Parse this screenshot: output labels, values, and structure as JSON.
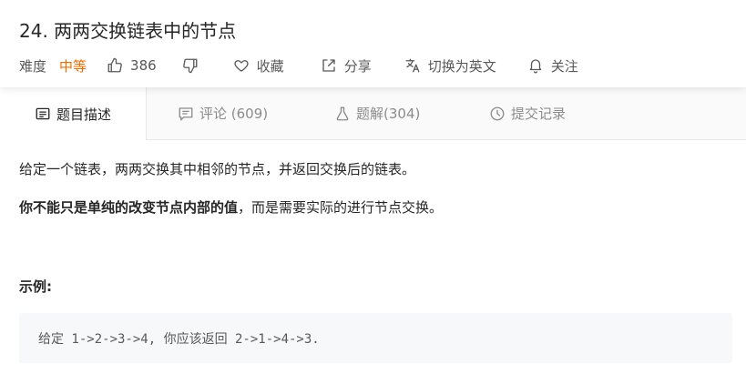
{
  "problem": {
    "title": "24. 两两交换链表中的节点"
  },
  "meta": {
    "difficulty_label": "难度",
    "difficulty_value": "中等",
    "difficulty_color": "#ef6c00",
    "likes": "386",
    "favorite_label": "收藏",
    "share_label": "分享",
    "switch_lang_label": "切换为英文",
    "follow_label": "关注",
    "icons": [
      "thumbs-up-icon",
      "thumbs-down-icon",
      "heart-icon",
      "share-icon",
      "translate-icon",
      "bell-icon"
    ]
  },
  "tabs": [
    {
      "label": "题目描述",
      "icon": "description-icon",
      "active": true
    },
    {
      "label": "评论 (609)",
      "icon": "comment-icon",
      "active": false
    },
    {
      "label": "题解(304)",
      "icon": "flask-icon",
      "active": false
    },
    {
      "label": "提交记录",
      "icon": "clock-icon",
      "active": false
    }
  ],
  "description": {
    "p1": "给定一个链表，两两交换其中相邻的节点，并返回交换后的链表。",
    "p2_bold": "你不能只是单纯的改变节点内部的值",
    "p2_rest": "，而是需要实际的进行节点交换。",
    "example_title": "示例:",
    "example_code": "给定 1->2->3->4, 你应该返回 2->1->4->3."
  }
}
